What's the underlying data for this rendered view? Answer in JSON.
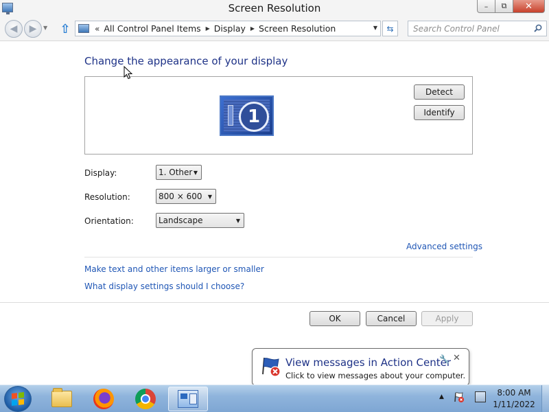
{
  "window": {
    "title": "Screen Resolution",
    "controls": {
      "minimize": "–",
      "maximize": "⧉",
      "close": "✕"
    }
  },
  "navbar": {
    "breadcrumb_prefix": "«",
    "breadcrumbs": [
      "All Control Panel Items",
      "Display",
      "Screen Resolution"
    ],
    "search_placeholder": "Search Control Panel"
  },
  "main": {
    "heading": "Change the appearance of your display",
    "monitor_number": "1",
    "detect_label": "Detect",
    "identify_label": "Identify",
    "display_label": "Display:",
    "display_value": "1. Other",
    "resolution_label": "Resolution:",
    "resolution_value": "800 × 600",
    "orientation_label": "Orientation:",
    "orientation_value": "Landscape",
    "advanced_link": "Advanced settings",
    "text_size_link": "Make text and other items larger or smaller",
    "help_link": "What display settings should I choose?"
  },
  "footer": {
    "ok_label": "OK",
    "cancel_label": "Cancel",
    "apply_label": "Apply"
  },
  "notification": {
    "title": "View messages in Action Center",
    "body": "Click to view messages about your computer."
  },
  "taskbar": {
    "items": [
      "start-button",
      "file-explorer",
      "firefox",
      "chrome",
      "control-panel"
    ],
    "clock_time": "8:00 AM",
    "clock_date": "1/11/2022"
  },
  "colors": {
    "heading": "#1e3287",
    "link": "#1f56b5",
    "taskbar": "#8fb4dc"
  }
}
